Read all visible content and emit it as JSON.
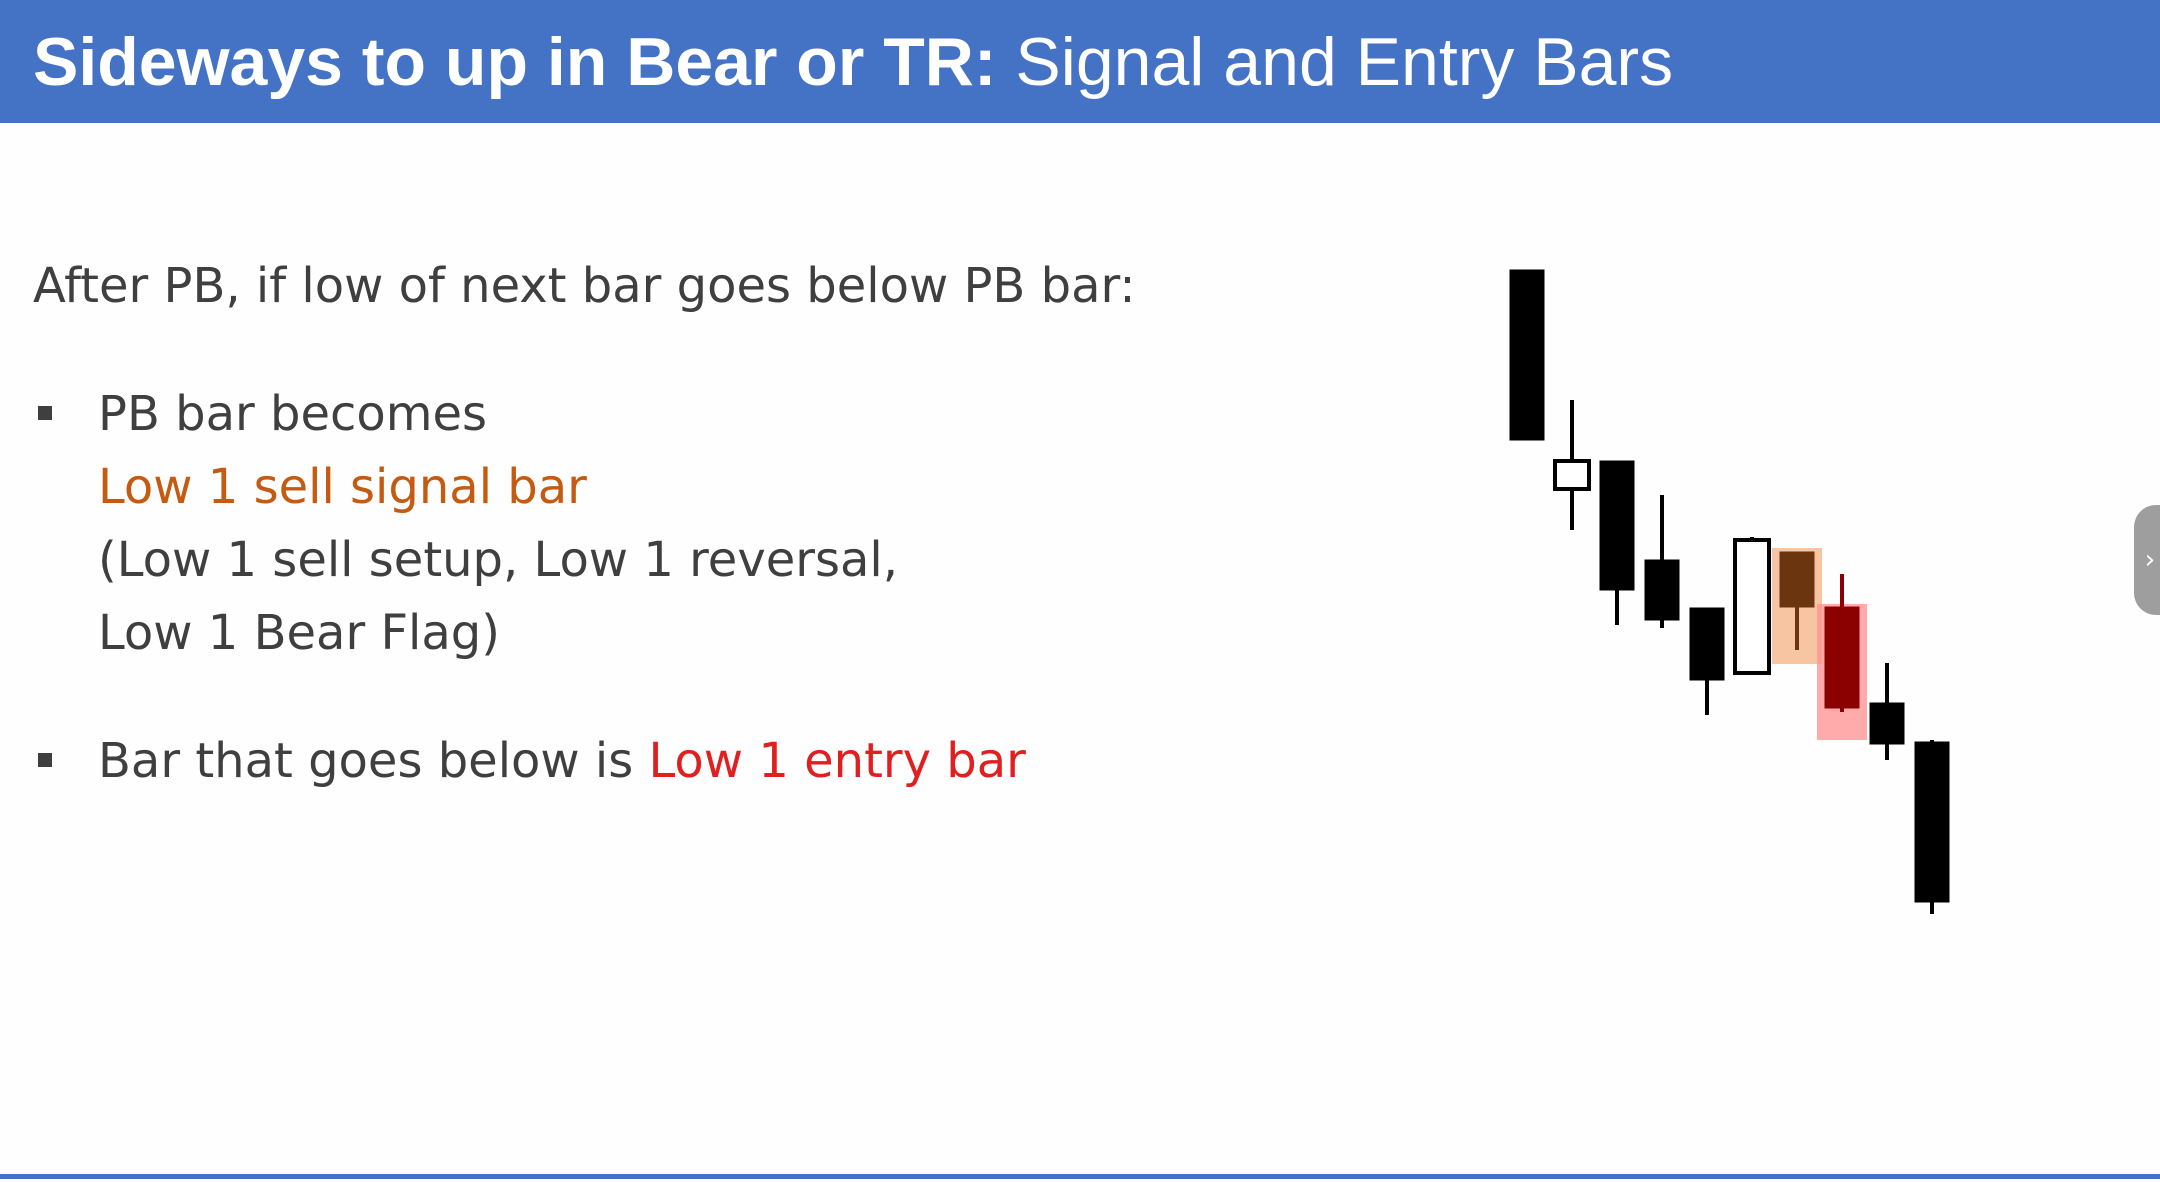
{
  "slide": {
    "title_bold": "Sideways to up in Bear or TR:",
    "title_regular": " Signal and Entry Bars",
    "intro": "After PB, if low of next bar goes below PB bar:",
    "bullet1": {
      "line1": "PB bar becomes",
      "highlight": "Low 1 sell signal bar",
      "line3": "(Low 1 sell setup, Low 1 reversal,",
      "line4": "Low 1 Bear Flag)"
    },
    "bullet2": {
      "text": "Bar that goes below is ",
      "highlight": "Low 1 entry bar"
    }
  },
  "colors": {
    "header_bg": "#4472c4",
    "signal_text": "#c55a11",
    "entry_text": "#e02020",
    "signal_highlight": "#f4b183",
    "entry_highlight": "#ff8f8f",
    "signal_bar": "#6b3510",
    "entry_bar": "#8b0000"
  },
  "side_tab": {
    "icon": "chevron-right-icon",
    "glyph": "›"
  },
  "chart_data": {
    "type": "candlestick",
    "bars": [
      {
        "open": 1000,
        "close": 830,
        "high": 1000,
        "low": 830,
        "bull": false
      },
      {
        "open": 809,
        "close": 781,
        "high": 870,
        "low": 740,
        "bull": true
      },
      {
        "open": 809,
        "close": 680,
        "high": 809,
        "low": 645,
        "bull": false
      },
      {
        "open": 710,
        "close": 650,
        "high": 775,
        "low": 642,
        "bull": false
      },
      {
        "open": 662,
        "close": 590,
        "high": 662,
        "low": 555,
        "bull": false
      },
      {
        "open": 597,
        "close": 730,
        "high": 733,
        "low": 597,
        "bull": true
      },
      {
        "open": 718,
        "close": 663,
        "high": 718,
        "low": 620,
        "bull": false,
        "role": "signal"
      },
      {
        "open": 663,
        "close": 562,
        "high": 696,
        "low": 558,
        "bull": false,
        "role": "entry"
      },
      {
        "open": 567,
        "close": 526,
        "high": 607,
        "low": 510,
        "bull": false
      },
      {
        "open": 528,
        "close": 368,
        "high": 530,
        "low": 356,
        "bull": false
      }
    ]
  }
}
